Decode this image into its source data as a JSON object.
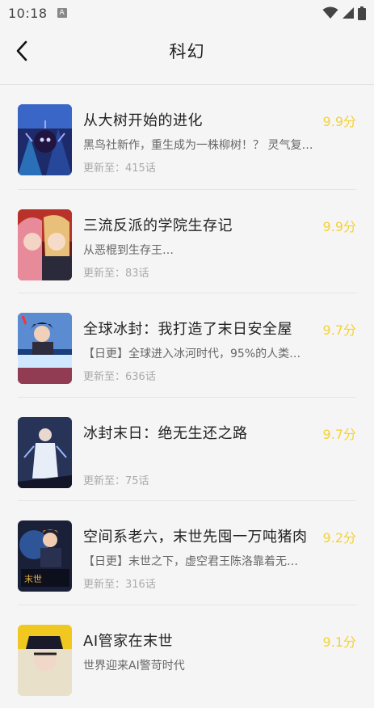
{
  "status_bar": {
    "time": "10:18",
    "notification_icon": "a-notification-icon",
    "icons": [
      "wifi-icon",
      "signal-icon",
      "battery-icon"
    ]
  },
  "header": {
    "back_icon": "chevron-left-icon",
    "title": "科幻"
  },
  "colors": {
    "score": "#f4d233",
    "background": "#f5f5f5",
    "title_text": "#222222",
    "desc_text": "#666666",
    "meta_text": "#aaaaaa"
  },
  "items": [
    {
      "title": "从大树开始的进化",
      "score": "9.9分",
      "desc": "黑鸟社新作，重生成为一株柳树！？ 灵气复苏…",
      "update_prefix": "更新至：",
      "update_count": "415话"
    },
    {
      "title": "三流反派的学院生存记",
      "score": "9.9分",
      "desc": "从恶棍到生存王…",
      "update_prefix": "更新至：",
      "update_count": "83话"
    },
    {
      "title": "全球冰封：我打造了末日安全屋",
      "score": "9.7分",
      "desc": "【日更】全球进入冰河时代，95%的人类…",
      "update_prefix": "更新至：",
      "update_count": "636话"
    },
    {
      "title": "冰封末日：绝无生还之路",
      "score": "9.7分",
      "desc": "",
      "update_prefix": "更新至：",
      "update_count": "75话"
    },
    {
      "title": "空间系老六，末世先囤一万吨猪肉",
      "score": "9.2分",
      "desc": "【日更】末世之下，虚空君王陈洛靠着无…",
      "update_prefix": "更新至：",
      "update_count": "316话"
    },
    {
      "title": "AI管家在末世",
      "score": "9.1分",
      "desc": "世界迎来AI警苛时代",
      "update_prefix": "",
      "update_count": ""
    }
  ]
}
